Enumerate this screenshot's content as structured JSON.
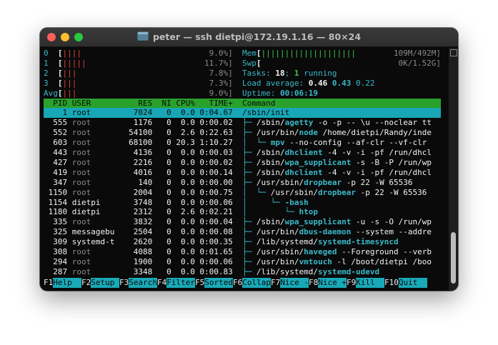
{
  "window": {
    "title": "peter — ssh dietpi@172.19.1.16 — 80×24"
  },
  "meters": {
    "cpu": [
      {
        "label": "0",
        "bar": "||||",
        "value": "9.0%]"
      },
      {
        "label": "1",
        "bar": "|||||",
        "value": "11.7%]"
      },
      {
        "label": "2",
        "bar": "|||",
        "value": "7.8%]"
      },
      {
        "label": "3",
        "bar": "|||",
        "value": "7.3%]"
      },
      {
        "label": "Avg",
        "bar": "|||",
        "value": "9.0%]"
      }
    ],
    "mem": {
      "label": "Mem",
      "bar": "||||||||||||||||||||",
      "value": "109M/492M]"
    },
    "swp": {
      "label": "Swp",
      "value": "0K/1.52G]"
    },
    "tasks": {
      "label": "Tasks: ",
      "count": "18",
      "sep": "; ",
      "running": "1",
      "running_label": " running"
    },
    "load": {
      "label": "Load average: ",
      "v1": "0.46",
      "v2": "0.43",
      "v3": "0.22"
    },
    "uptime": {
      "label": "Uptime: ",
      "value": "00:06:19"
    }
  },
  "table": {
    "headers": {
      "pid": "PID",
      "user": "USER",
      "res": "RES",
      "ni": "NI",
      "cpu": "CPU%",
      "time": "TIME+",
      "command": "Command"
    },
    "rows": [
      {
        "pid": "1",
        "user": "root",
        "res": "7024",
        "ni": "0",
        "cpu": "0.0",
        "time": "0:04.67",
        "tree": "",
        "cmd": "/sbin/init",
        "args": ""
      },
      {
        "pid": "555",
        "user": "root",
        "res": "1176",
        "ni": "0",
        "cpu": "0.0",
        "time": "0:00.02",
        "tree": "├─ ",
        "cmd": "/sbin/agetty",
        "args": " -o -p -- \\u --noclear tt"
      },
      {
        "pid": "552",
        "user": "root",
        "res": "54100",
        "ni": "0",
        "cpu": "2.6",
        "time": "0:22.63",
        "tree": "├─ ",
        "cmd": "/usr/bin/node",
        "args": " /home/dietpi/Randy/inde"
      },
      {
        "pid": "603",
        "user": "root",
        "res": "68100",
        "ni": "0",
        "cpu": "20.3",
        "time": "1:10.27",
        "tree": "│  └─ ",
        "cmd": "mpv",
        "args": " --no-config --af-clr --vf-clr"
      },
      {
        "pid": "443",
        "user": "root",
        "res": "4136",
        "ni": "0",
        "cpu": "0.0",
        "time": "0:00.03",
        "tree": "├─ ",
        "cmd": "/sbin/dhclient",
        "args": " -4 -v -i -pf /run/dhcl"
      },
      {
        "pid": "427",
        "user": "root",
        "res": "2216",
        "ni": "0",
        "cpu": "0.0",
        "time": "0:00.02",
        "tree": "├─ ",
        "cmd": "/sbin/wpa_supplicant",
        "args": " -s -B -P /run/wp"
      },
      {
        "pid": "419",
        "user": "root",
        "res": "4016",
        "ni": "0",
        "cpu": "0.0",
        "time": "0:00.14",
        "tree": "├─ ",
        "cmd": "/sbin/dhclient",
        "args": " -4 -v -i -pf /run/dhcl"
      },
      {
        "pid": "347",
        "user": "root",
        "res": "140",
        "ni": "0",
        "cpu": "0.0",
        "time": "0:00.00",
        "tree": "├─ ",
        "cmd": "/usr/sbin/dropbear",
        "args": " -p 22 -W 65536"
      },
      {
        "pid": "1150",
        "user": "root",
        "res": "2004",
        "ni": "0",
        "cpu": "0.0",
        "time": "0:00.75",
        "tree": "│  └─ ",
        "cmd": "/usr/sbin/dropbear",
        "args": " -p 22 -W 65536"
      },
      {
        "pid": "1154",
        "user": "dietpi",
        "res": "3748",
        "ni": "0",
        "cpu": "0.0",
        "time": "0:00.06",
        "tree": "│     └─ ",
        "cmd": "-bash",
        "args": ""
      },
      {
        "pid": "1180",
        "user": "dietpi",
        "res": "2312",
        "ni": "0",
        "cpu": "2.6",
        "time": "0:02.21",
        "tree": "│        └─ ",
        "cmd": "htop",
        "args": ""
      },
      {
        "pid": "335",
        "user": "root",
        "res": "3832",
        "ni": "0",
        "cpu": "0.0",
        "time": "0:00.04",
        "tree": "├─ ",
        "cmd": "/sbin/wpa_supplicant",
        "args": " -u -s -O /run/wp"
      },
      {
        "pid": "325",
        "user": "messagebu",
        "res": "2504",
        "ni": "0",
        "cpu": "0.0",
        "time": "0:00.08",
        "tree": "├─ ",
        "cmd": "/usr/bin/dbus-daemon",
        "args": " --system --addre"
      },
      {
        "pid": "309",
        "user": "systemd-t",
        "res": "2620",
        "ni": "0",
        "cpu": "0.0",
        "time": "0:00.35",
        "tree": "├─ ",
        "cmd": "/lib/systemd/systemd-timesyncd",
        "args": ""
      },
      {
        "pid": "308",
        "user": "root",
        "res": "4088",
        "ni": "0",
        "cpu": "0.0",
        "time": "0:01.65",
        "tree": "├─ ",
        "cmd": "/usr/sbin/haveged",
        "args": " --Foreground --verb"
      },
      {
        "pid": "294",
        "user": "root",
        "res": "1900",
        "ni": "0",
        "cpu": "0.0",
        "time": "0:00.06",
        "tree": "├─ ",
        "cmd": "/usr/bin/vmtouch",
        "args": " -l /boot/dietpi /boo"
      },
      {
        "pid": "287",
        "user": "root",
        "res": "3348",
        "ni": "0",
        "cpu": "0.0",
        "time": "0:00.83",
        "tree": "├─ ",
        "cmd": "/lib/systemd/systemd-udevd",
        "args": ""
      }
    ]
  },
  "fkeys": [
    {
      "key": "F1",
      "label": "Help  "
    },
    {
      "key": "F2",
      "label": "Setup "
    },
    {
      "key": "F3",
      "label": "Search"
    },
    {
      "key": "F4",
      "label": "Filter"
    },
    {
      "key": "F5",
      "label": "Sorted"
    },
    {
      "key": "F6",
      "label": "Collap"
    },
    {
      "key": "F7",
      "label": "Nice -"
    },
    {
      "key": "F8",
      "label": "Nice +"
    },
    {
      "key": "F9",
      "label": "Kill  "
    },
    {
      "key": "F10",
      "label": "Quit  "
    }
  ],
  "colors": {
    "header_bar": "#29a12b",
    "selected_row": "#17a7b6",
    "fkey_label_bg": "#19a9b8"
  }
}
